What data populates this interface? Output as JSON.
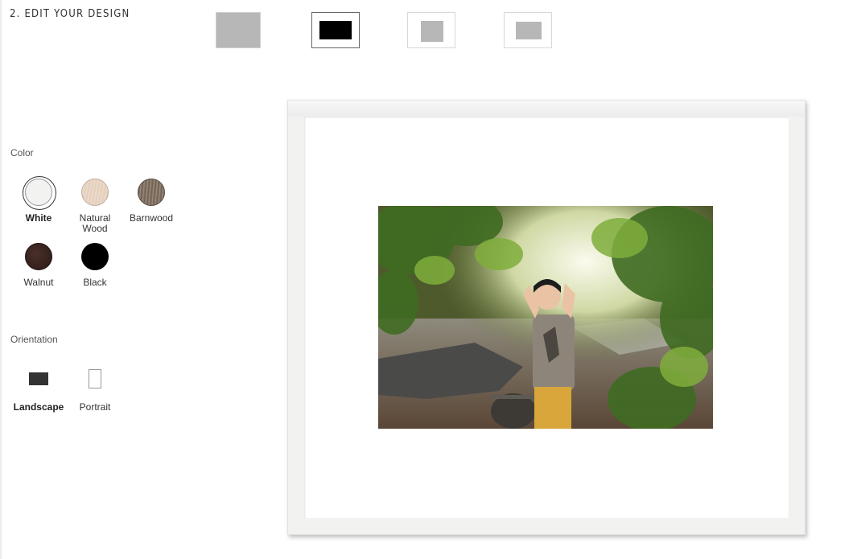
{
  "header": {
    "step_title": "2. EDIT YOUR DESIGN"
  },
  "style_options": [
    {
      "name": "full-bleed",
      "selected": false
    },
    {
      "name": "black-mat",
      "selected": true
    },
    {
      "name": "white-mat-square",
      "selected": false
    },
    {
      "name": "white-mat-landscape",
      "selected": false
    }
  ],
  "color_section": {
    "label": "Color",
    "options": [
      {
        "label": "White",
        "selected": true,
        "color": "#f2f2f0"
      },
      {
        "label": "Natural\nWood",
        "selected": false,
        "color": "#e8d5c3"
      },
      {
        "label": "Barnwood",
        "selected": false,
        "color": "#7d6e60"
      },
      {
        "label": "Walnut",
        "selected": false,
        "color": "#3a241f"
      },
      {
        "label": "Black",
        "selected": false,
        "color": "#000000"
      }
    ]
  },
  "orientation_section": {
    "label": "Orientation",
    "options": [
      {
        "label": "Landscape",
        "selected": true
      },
      {
        "label": "Portrait",
        "selected": false
      }
    ]
  },
  "preview": {
    "frame_color": "#f2f2f1",
    "mat_color": "#ffffff"
  }
}
